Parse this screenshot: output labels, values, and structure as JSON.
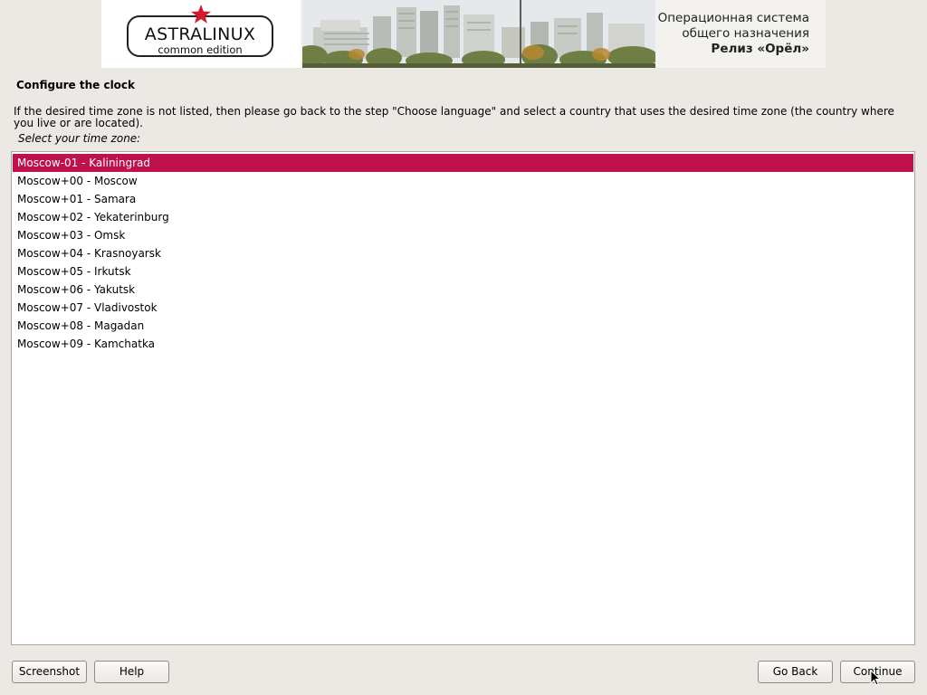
{
  "banner": {
    "logo_name": "ASTRALINUX",
    "logo_edition": "common edition",
    "line1": "Операционная система",
    "line2": "общего назначения",
    "release": "Релиз «Орёл»"
  },
  "page": {
    "title": "Configure the clock",
    "description": "If the desired time zone is not listed, then please go back to the step \"Choose language\" and select a country that uses the desired time zone (the country where you live or are located).",
    "prompt": "Select your time zone:"
  },
  "timezones": [
    "Moscow-01 - Kaliningrad",
    "Moscow+00 - Moscow",
    "Moscow+01 - Samara",
    "Moscow+02 - Yekaterinburg",
    "Moscow+03 - Omsk",
    "Moscow+04 - Krasnoyarsk",
    "Moscow+05 - Irkutsk",
    "Moscow+06 - Yakutsk",
    "Moscow+07 - Vladivostok",
    "Moscow+08 - Magadan",
    "Moscow+09 - Kamchatka"
  ],
  "selected_timezone": "Moscow-01 - Kaliningrad",
  "buttons": {
    "screenshot": "Screenshot",
    "help": "Help",
    "go_back": "Go Back",
    "continue": "Continue"
  },
  "colors": {
    "selection": "#c0114f",
    "background": "#ece9e4",
    "logo_star": "#d2192f"
  }
}
